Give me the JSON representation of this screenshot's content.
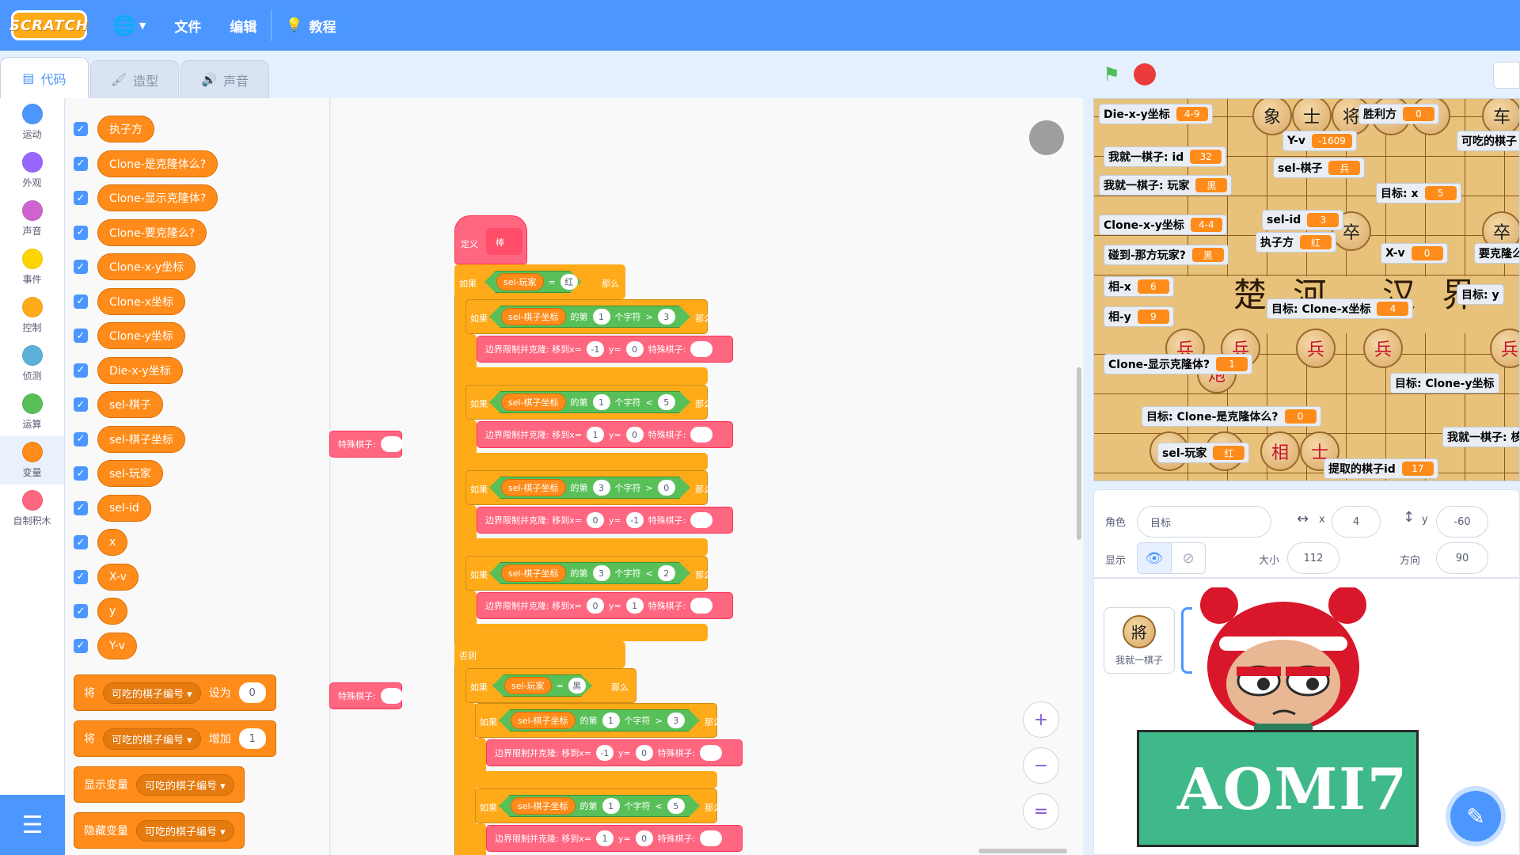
{
  "menu": {
    "logo": "SCRATCH",
    "globe_icon": "globe-icon",
    "file": "文件",
    "edit": "编辑",
    "tutorial": "教程"
  },
  "tabs": [
    {
      "label": "代码",
      "icon": "code-icon"
    },
    {
      "label": "造型",
      "icon": "brush-icon"
    },
    {
      "label": "声音",
      "icon": "speaker-icon"
    }
  ],
  "categories": [
    {
      "label": "运动",
      "color": "#4c97ff"
    },
    {
      "label": "外观",
      "color": "#9966ff"
    },
    {
      "label": "声音",
      "color": "#cf63cf"
    },
    {
      "label": "事件",
      "color": "#ffd500"
    },
    {
      "label": "控制",
      "color": "#ffab19"
    },
    {
      "label": "侦测",
      "color": "#5cb1d6"
    },
    {
      "label": "运算",
      "color": "#59c059"
    },
    {
      "label": "变量",
      "color": "#ff8c1a"
    },
    {
      "label": "自制积木",
      "color": "#ff6680"
    }
  ],
  "palette": {
    "variables": [
      "执子方",
      "Clone-是克隆体么?",
      "Clone-显示克隆体?",
      "Clone-要克隆么?",
      "Clone-x-y坐标",
      "Clone-x坐标",
      "Clone-y坐标",
      "Die-x-y坐标",
      "sel-棋子",
      "sel-棋子坐标",
      "sel-玩家",
      "sel-id",
      "x",
      "X-v",
      "y",
      "Y-v"
    ],
    "set_block": {
      "prefix": "将",
      "var": "可吃的棋子编号",
      "verb": "设为",
      "value": "0"
    },
    "change_block": {
      "prefix": "将",
      "var": "可吃的棋子编号",
      "verb": "增加",
      "value": "1"
    },
    "show_block": {
      "label": "显示变量",
      "var": "可吃的棋子编号"
    },
    "hide_block": {
      "label": "隐藏变量",
      "var": "可吃的棋子编号"
    },
    "overlay_label": "特殊棋子:"
  },
  "script": {
    "define_label": "定义",
    "define_name": "棒",
    "if": "如果",
    "then": "那么",
    "else": "否则",
    "of": "的第",
    "char": "个字符",
    "player_var": "sel-玩家",
    "coord_var": "sel-棋子坐标",
    "red": "红",
    "black": "黑",
    "stmt_prefix": "边界限制并克隆: 移到x=",
    "stmt_y": "y=",
    "stmt_special": "特殊棋子:",
    "conditions": [
      {
        "idx": "1",
        "op": ">",
        "val": "3",
        "x": "-1",
        "y": "0"
      },
      {
        "idx": "1",
        "op": "<",
        "val": "5",
        "x": "1",
        "y": "0"
      },
      {
        "idx": "3",
        "op": ">",
        "val": "0",
        "x": "0",
        "y": "-1"
      },
      {
        "idx": "3",
        "op": "<",
        "val": "2",
        "x": "0",
        "y": "1"
      }
    ],
    "else_conditions": [
      {
        "idx": "1",
        "op": ">",
        "val": "3",
        "x": "-1",
        "y": "0"
      },
      {
        "idx": "1",
        "op": "<",
        "val": "5",
        "x": "1",
        "y": "0"
      }
    ]
  },
  "zoom": {
    "in": "+",
    "out": "−",
    "reset": "="
  },
  "stage": {
    "river_left": "楚 河",
    "river_right": "汉 界",
    "monitors": [
      {
        "label": "Die-x-y坐标",
        "value": "4-9"
      },
      {
        "label": "胜利方",
        "value": "0"
      },
      {
        "label": "Y-v",
        "value": "-1609"
      },
      {
        "label": "可吃的棋子",
        "value": ""
      },
      {
        "label": "我就一棋子: id",
        "value": "32"
      },
      {
        "label": "sel-棋子",
        "value": "兵"
      },
      {
        "label": "我就一棋子: 玩家",
        "value": "黑"
      },
      {
        "label": "目标: x",
        "value": "5"
      },
      {
        "label": "sel-id",
        "value": "3"
      },
      {
        "label": "Clone-x-y坐标",
        "value": "4-4"
      },
      {
        "label": "执子方",
        "value": "红"
      },
      {
        "label": "碰到-那方玩家?",
        "value": "黑"
      },
      {
        "label": "X-v",
        "value": "0"
      },
      {
        "label": "要克隆么",
        "value": ""
      },
      {
        "label": "相-x",
        "value": "6"
      },
      {
        "label": "目标: y",
        "value": ""
      },
      {
        "label": "相-y",
        "value": "9"
      },
      {
        "label": "目标: Clone-x坐标",
        "value": "4"
      },
      {
        "label": "Clone-显示克隆体?",
        "value": "1"
      },
      {
        "label": "目标: Clone-y坐标",
        "value": ""
      },
      {
        "label": "目标: Clone-是克隆体么?",
        "value": "0"
      },
      {
        "label": "我就一棋子: 核",
        "value": ""
      },
      {
        "label": "sel-玩家",
        "value": "红"
      },
      {
        "label": "提取的棋子id",
        "value": "17"
      }
    ],
    "pieces_top": [
      "象",
      "士",
      "将",
      "士",
      "象",
      "车"
    ],
    "pieces_mid": [
      "卒",
      "卒"
    ],
    "pieces_red": [
      "兵",
      "兵",
      "兵",
      "兵",
      "兵"
    ],
    "pieces_bottom": [
      "炮",
      "車",
      "馬",
      "相",
      "士"
    ]
  },
  "sprite_info": {
    "sprite_label": "角色",
    "sprite_name": "目标",
    "x_label": "x",
    "x_value": "4",
    "y_label": "y",
    "y_value": "-60",
    "show_label": "显示",
    "size_label": "大小",
    "size_value": "112",
    "dir_label": "方向",
    "dir_value": "90"
  },
  "sprites": [
    {
      "name": "我就一棋子",
      "glyph": "將"
    }
  ],
  "watermark": "AOMI7"
}
